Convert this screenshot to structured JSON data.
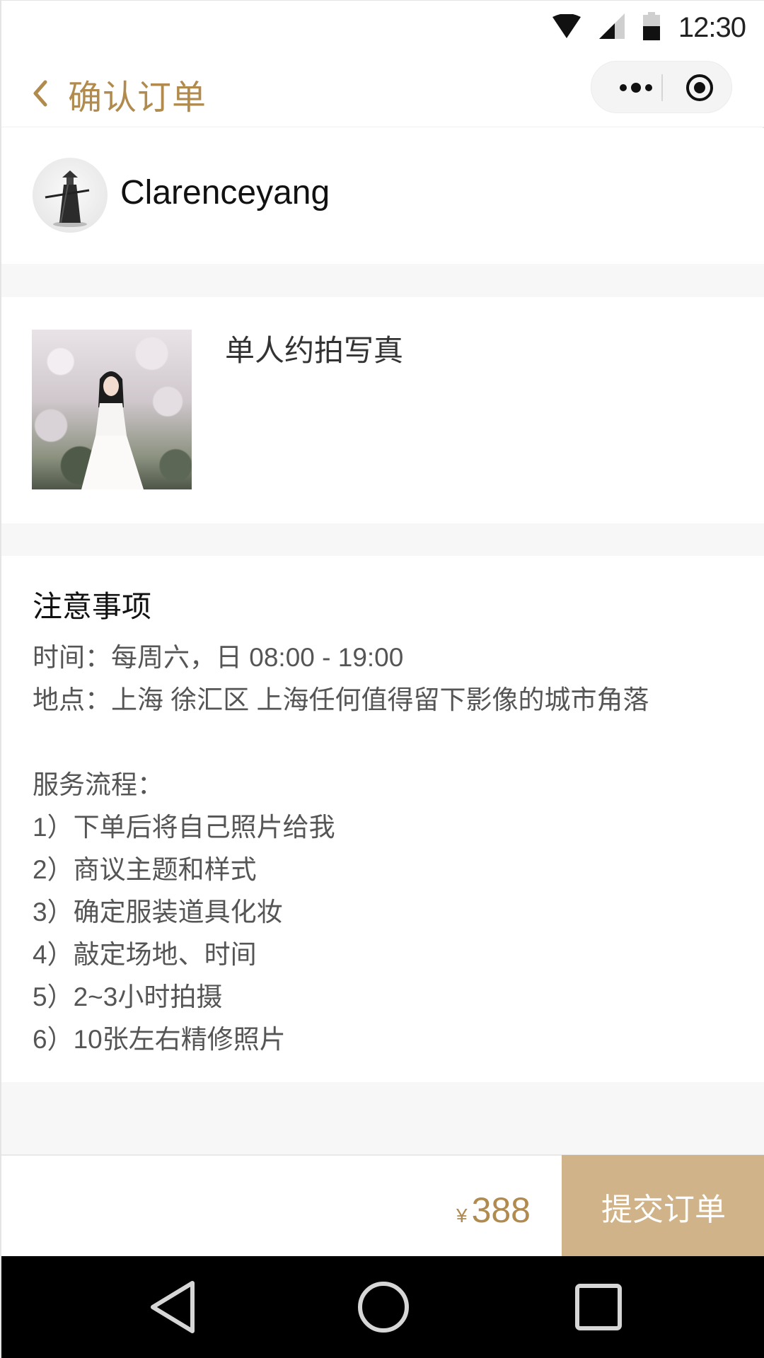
{
  "status_bar": {
    "time": "12:30",
    "icons": [
      "wifi-icon",
      "signal-icon",
      "battery-icon"
    ]
  },
  "nav": {
    "title": "确认订单",
    "icons": [
      "chevron-left-icon",
      "more-icon",
      "close-target-icon"
    ]
  },
  "user": {
    "name": "Clarenceyang"
  },
  "product": {
    "title": "单人约拍写真"
  },
  "notes": {
    "title": "注意事项",
    "lines": [
      "时间：每周六，日 08:00 - 19:00",
      "地点：上海 徐汇区 上海任何值得留下影像的城市角落",
      "",
      "服务流程：",
      "1）下单后将自己照片给我",
      "2）商议主题和样式",
      "3）确定服装道具化妆",
      "4）敲定场地、时间",
      "5）2~3小时拍摄",
      "6）10张左右精修照片"
    ]
  },
  "order": {
    "currency": "¥",
    "price": "388",
    "submit_label": "提交订单"
  },
  "colors": {
    "accent": "#b18a4e",
    "button": "#d0b388",
    "divider": "#f7f7f7"
  }
}
